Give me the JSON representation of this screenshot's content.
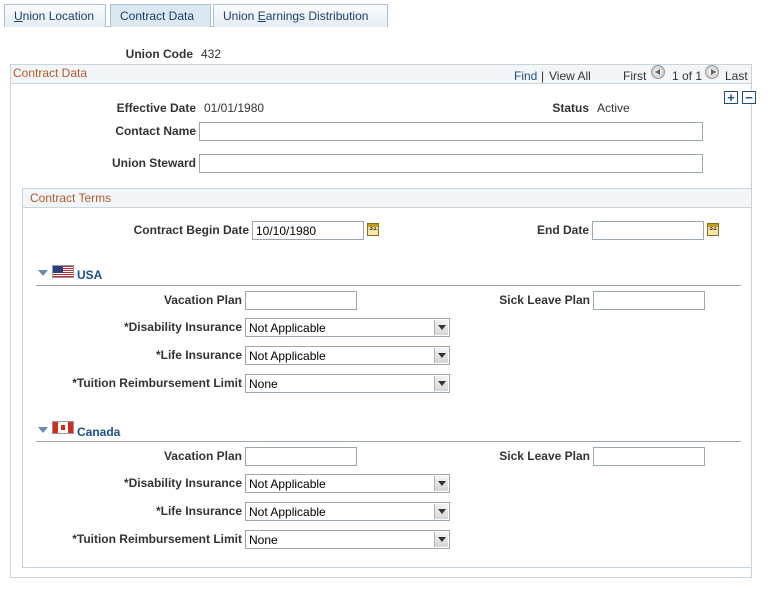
{
  "tabs": [
    {
      "label": "Union Location",
      "accel_index": 0
    },
    {
      "label": "Contract Data",
      "accel_index": -1
    },
    {
      "label": "Union Earnings Distribution",
      "accel_index": 6
    }
  ],
  "union_code": {
    "label": "Union Code",
    "value": "432"
  },
  "contract_data": {
    "title": "Contract Data",
    "nav": {
      "find": "Find",
      "sep": "|",
      "view_all": "View All",
      "first": "First",
      "count": "1 of 1",
      "last": "Last"
    },
    "effective_date": {
      "label": "Effective Date",
      "value": "01/01/1980"
    },
    "status": {
      "label": "Status",
      "value": "Active"
    },
    "add_label": "+",
    "remove_label": "−",
    "contact_name": {
      "label": "Contact Name",
      "value": ""
    },
    "union_steward": {
      "label": "Union Steward",
      "value": ""
    }
  },
  "contract_terms": {
    "title": "Contract Terms",
    "begin_date": {
      "label": "Contract Begin Date",
      "value": "10/10/1980"
    },
    "end_date": {
      "label": "End Date",
      "value": ""
    },
    "calendar_glyph": "31"
  },
  "usa": {
    "name": "USA",
    "vacation_plan": {
      "label": "Vacation Plan",
      "value": ""
    },
    "sick_leave_plan": {
      "label": "Sick Leave Plan",
      "value": ""
    },
    "disability": {
      "label": "*Disability Insurance",
      "value": "Not Applicable"
    },
    "life": {
      "label": "*Life Insurance",
      "value": "Not Applicable"
    },
    "tuition": {
      "label": "*Tuition Reimbursement Limit",
      "value": "None"
    }
  },
  "canada": {
    "name": "Canada",
    "vacation_plan": {
      "label": "Vacation Plan",
      "value": ""
    },
    "sick_leave_plan": {
      "label": "Sick Leave Plan",
      "value": ""
    },
    "disability": {
      "label": "*Disability Insurance",
      "value": "Not Applicable"
    },
    "life": {
      "label": "*Life Insurance",
      "value": "Not Applicable"
    },
    "tuition": {
      "label": "*Tuition Reimbursement Limit",
      "value": "None"
    }
  },
  "colors": {
    "section_header": "#b2592a",
    "link": "#1b4f8b",
    "tab_text": "#1b3f6b"
  }
}
